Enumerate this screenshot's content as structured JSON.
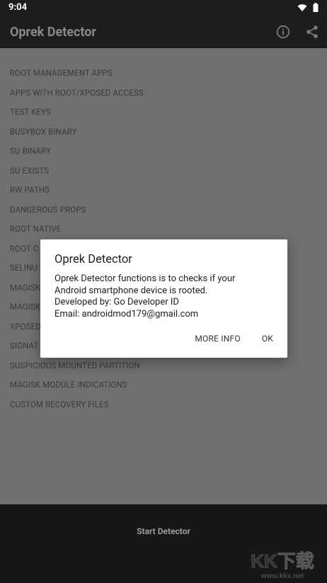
{
  "status": {
    "time": "9:04"
  },
  "appbar": {
    "title": "Oprek Detector",
    "info_icon": "info-icon",
    "share_icon": "share-icon"
  },
  "checks": [
    "ROOT MANAGEMENT APPS",
    "APPS WITH ROOT/XPOSED ACCESS",
    "TEST KEYS",
    "BUSYBOX BINARY",
    "SU BINARY",
    "SU EXISTS",
    "RW PATHS",
    "DANGEROUS PROPS",
    "ROOT NATIVE",
    "ROOT C",
    "SELINU",
    "MAGISK",
    "MAGISK",
    "XPOSED",
    "SIGNAT",
    "SUSPICIOUS MOUNTED PARTITION",
    "MAGISK MODULE INDICATIONS",
    "CUSTOM RECOVERY FILES"
  ],
  "dialog": {
    "title": "Oprek Detector",
    "message_lines": [
      "Oprek Detector functions is to checks if your",
      "Android smartphone device is rooted.",
      "Developed by: Go Developer ID",
      "Email: androidmod179@gmail.com"
    ],
    "more_info_label": "MORE INFO",
    "ok_label": "OK"
  },
  "bottom": {
    "start_label": "Start Detector"
  },
  "watermark": {
    "brand": "KK下载",
    "url": "www.kkx.net"
  },
  "colors": {
    "scrim": "#707070",
    "bar": "#1d1d1d",
    "bottom": "#171717",
    "dialog": "#ffffff"
  }
}
